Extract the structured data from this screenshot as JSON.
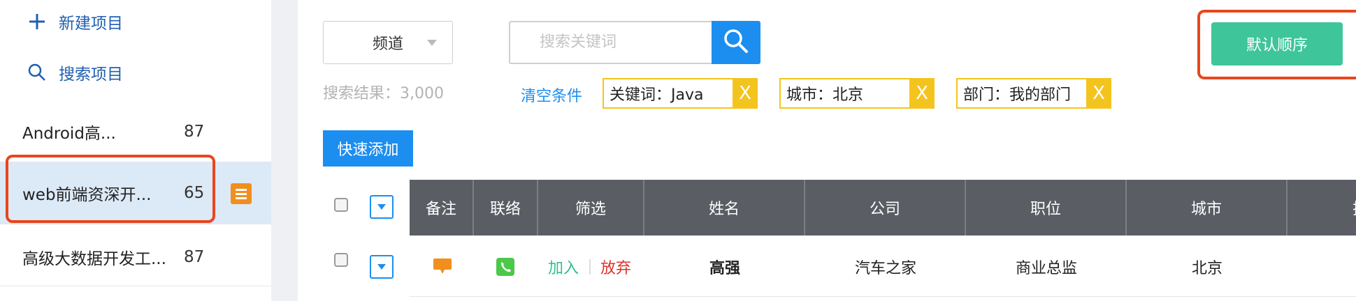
{
  "sidebar": {
    "new_project": "新建项目",
    "search_project": "搜索项目",
    "projects": [
      {
        "name": "Android高...",
        "count": "87"
      },
      {
        "name": "web前端资深开...",
        "count": "65"
      },
      {
        "name": "高级大数据开发工...",
        "count": "87"
      }
    ]
  },
  "filters": {
    "channel": "频道",
    "search_placeholder": "搜索关键词",
    "result_text": "搜索结果：3,000",
    "clear": "清空条件",
    "tags": [
      {
        "label": "关键词：Java",
        "x": "X"
      },
      {
        "label": "城市：北京",
        "x": "X"
      },
      {
        "label": "部门：我的部门",
        "x": "X"
      }
    ]
  },
  "actions": {
    "quick_add": "快速添加",
    "default_order": "默认顺序"
  },
  "table": {
    "headers": [
      "备注",
      "联络",
      "筛选",
      "姓名",
      "公司",
      "职位",
      "城市",
      "技能"
    ],
    "rows": [
      {
        "join": "加入",
        "abandon": "放弃",
        "name": "高强",
        "company": "汽车之家",
        "position": "商业总监",
        "city": "北京"
      }
    ]
  },
  "colors": {
    "accent": "#1c8ef0",
    "green": "#3ec59a",
    "tag": "#f4c41e",
    "highlight": "#e8461e",
    "header_bg": "#5a5d63"
  }
}
